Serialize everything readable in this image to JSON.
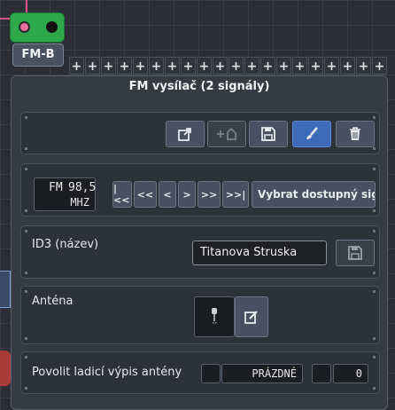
{
  "node": {
    "tab_label": "FM-B"
  },
  "plus_row": [
    "+",
    "+",
    "+",
    "+",
    "+",
    "+",
    "+",
    "+",
    "+",
    "+",
    "+",
    "+",
    "+",
    "+",
    "+",
    "+",
    "+",
    "+",
    "+",
    "+"
  ],
  "panel": {
    "title": "FM vysílač (2 signály)",
    "toolbar": {
      "icons": [
        "export-icon",
        "add-import-icon",
        "save-icon",
        "brush-icon",
        "trash-icon"
      ]
    },
    "tuner": {
      "frequency_value": "98,5",
      "frequency_prefix": "FM",
      "frequency_unit": "MHZ",
      "nav_buttons": [
        "|<<",
        "<<",
        "<",
        ">",
        ">>",
        ">>|"
      ],
      "find_button": "Vybrat dostupný sig"
    },
    "id3": {
      "label": "ID3 (název)",
      "value": "Titanova Struska"
    },
    "antenna": {
      "label": "Anténa"
    },
    "debug": {
      "label": "Povolit ladicí výpis antény",
      "status": "PRÁZDNÉ",
      "count": "0"
    }
  },
  "colors": {
    "accent_blue": "#3e6bb8",
    "node_green": "#2ea84a",
    "wire_pink": "#d94f8a"
  }
}
